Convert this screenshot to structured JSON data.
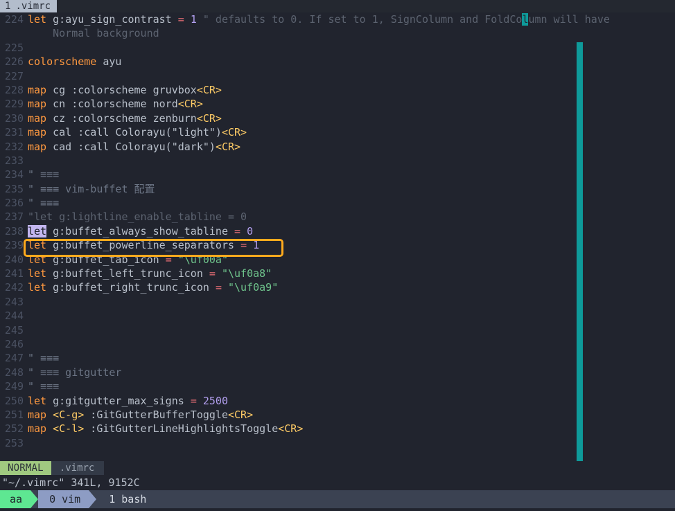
{
  "window": {
    "app": "vim",
    "bg_color": "#21242e",
    "accent_teal": "#0e9a9a",
    "annotation_color": "#ffaa1d"
  },
  "tabline": {
    "tabs": [
      {
        "number": "1",
        "name": ".vimrc",
        "active": true
      }
    ]
  },
  "editor": {
    "first_visible_line": 224,
    "cursor": {
      "line": 224,
      "char": "l",
      "word_context": "FoldColumn"
    },
    "lines": [
      {
        "num": "224",
        "segments": [
          {
            "t": "let",
            "c": "kw"
          },
          {
            "t": " g:ayu_sign_contrast ",
            "c": "ident"
          },
          {
            "t": "=",
            "c": "op"
          },
          {
            "t": " ",
            "c": "ident"
          },
          {
            "t": "1",
            "c": "num"
          },
          {
            "t": " ",
            "c": "ident"
          },
          {
            "t": "\" defaults to 0. If set to 1, SignColumn and FoldCo",
            "c": "cmt"
          },
          {
            "t": "l",
            "c": "cursor"
          },
          {
            "t": "umn will have",
            "c": "cmt"
          }
        ]
      },
      {
        "num": "",
        "segments": [
          {
            "t": "    Normal background",
            "c": "cmt"
          }
        ]
      },
      {
        "num": "225",
        "segments": []
      },
      {
        "num": "226",
        "segments": [
          {
            "t": "colorscheme",
            "c": "kw"
          },
          {
            "t": " ayu",
            "c": "ident"
          }
        ]
      },
      {
        "num": "227",
        "segments": []
      },
      {
        "num": "228",
        "segments": [
          {
            "t": "map",
            "c": "kw"
          },
          {
            "t": " cg :colorscheme gruvbox",
            "c": "ident"
          },
          {
            "t": "<CR>",
            "c": "spec"
          }
        ]
      },
      {
        "num": "229",
        "segments": [
          {
            "t": "map",
            "c": "kw"
          },
          {
            "t": " cn :colorscheme nord",
            "c": "ident"
          },
          {
            "t": "<CR>",
            "c": "spec"
          }
        ]
      },
      {
        "num": "230",
        "segments": [
          {
            "t": "map",
            "c": "kw"
          },
          {
            "t": " cz :colorscheme zenburn",
            "c": "ident"
          },
          {
            "t": "<CR>",
            "c": "spec"
          }
        ]
      },
      {
        "num": "231",
        "segments": [
          {
            "t": "map",
            "c": "kw"
          },
          {
            "t": " cal :call Colorayu(\"light\")",
            "c": "ident"
          },
          {
            "t": "<CR>",
            "c": "spec"
          }
        ]
      },
      {
        "num": "232",
        "segments": [
          {
            "t": "map",
            "c": "kw"
          },
          {
            "t": " cad :call Colorayu(\"dark\")",
            "c": "ident"
          },
          {
            "t": "<CR>",
            "c": "spec"
          }
        ]
      },
      {
        "num": "233",
        "segments": []
      },
      {
        "num": "234",
        "segments": [
          {
            "t": "\" ≡≡≡",
            "c": "cmt2"
          }
        ]
      },
      {
        "num": "235",
        "segments": [
          {
            "t": "\" ≡≡≡ vim-buffet 配置",
            "c": "cmt2"
          }
        ]
      },
      {
        "num": "236",
        "segments": [
          {
            "t": "\" ≡≡≡",
            "c": "cmt2"
          }
        ]
      },
      {
        "num": "237",
        "segments": [
          {
            "t": "\"let g:lightline_enable_tabline = 0",
            "c": "cmt"
          }
        ]
      },
      {
        "num": "238",
        "boxed": true,
        "segments": [
          {
            "t": "let",
            "c": "sel"
          },
          {
            "t": " g:buffet_always_show_tabline ",
            "c": "ident"
          },
          {
            "t": "=",
            "c": "op"
          },
          {
            "t": " ",
            "c": "ident"
          },
          {
            "t": "0",
            "c": "num"
          }
        ]
      },
      {
        "num": "239",
        "segments": [
          {
            "t": "let",
            "c": "kw"
          },
          {
            "t": " g:buffet_powerline_separators ",
            "c": "ident"
          },
          {
            "t": "=",
            "c": "op"
          },
          {
            "t": " ",
            "c": "ident"
          },
          {
            "t": "1",
            "c": "num"
          }
        ]
      },
      {
        "num": "240",
        "segments": [
          {
            "t": "let",
            "c": "kw"
          },
          {
            "t": " g:buffet_tab_icon ",
            "c": "ident"
          },
          {
            "t": "=",
            "c": "op"
          },
          {
            "t": " ",
            "c": "ident"
          },
          {
            "t": "\"\\uf00a\"",
            "c": "str"
          }
        ]
      },
      {
        "num": "241",
        "segments": [
          {
            "t": "let",
            "c": "kw"
          },
          {
            "t": " g:buffet_left_trunc_icon ",
            "c": "ident"
          },
          {
            "t": "=",
            "c": "op"
          },
          {
            "t": " ",
            "c": "ident"
          },
          {
            "t": "\"\\uf0a8\"",
            "c": "str"
          }
        ]
      },
      {
        "num": "242",
        "segments": [
          {
            "t": "let",
            "c": "kw"
          },
          {
            "t": " g:buffet_right_trunc_icon ",
            "c": "ident"
          },
          {
            "t": "=",
            "c": "op"
          },
          {
            "t": " ",
            "c": "ident"
          },
          {
            "t": "\"\\uf0a9\"",
            "c": "str"
          }
        ]
      },
      {
        "num": "243",
        "segments": []
      },
      {
        "num": "244",
        "segments": []
      },
      {
        "num": "245",
        "segments": []
      },
      {
        "num": "246",
        "segments": []
      },
      {
        "num": "247",
        "segments": [
          {
            "t": "\" ≡≡≡",
            "c": "cmt2"
          }
        ]
      },
      {
        "num": "248",
        "segments": [
          {
            "t": "\" ≡≡≡ gitgutter",
            "c": "cmt2"
          }
        ]
      },
      {
        "num": "249",
        "segments": [
          {
            "t": "\" ≡≡≡",
            "c": "cmt2"
          }
        ]
      },
      {
        "num": "250",
        "segments": [
          {
            "t": "let",
            "c": "kw"
          },
          {
            "t": " g:gitgutter_max_signs ",
            "c": "ident"
          },
          {
            "t": "=",
            "c": "op"
          },
          {
            "t": " ",
            "c": "ident"
          },
          {
            "t": "2500",
            "c": "num"
          }
        ]
      },
      {
        "num": "251",
        "segments": [
          {
            "t": "map",
            "c": "kw"
          },
          {
            "t": " ",
            "c": "ident"
          },
          {
            "t": "<C-g>",
            "c": "spec"
          },
          {
            "t": " :GitGutterBufferToggle",
            "c": "ident"
          },
          {
            "t": "<CR>",
            "c": "spec"
          }
        ]
      },
      {
        "num": "252",
        "segments": [
          {
            "t": "map",
            "c": "kw"
          },
          {
            "t": " ",
            "c": "ident"
          },
          {
            "t": "<C-l>",
            "c": "spec"
          },
          {
            "t": " :GitGutterLineHighlightsToggle",
            "c": "ident"
          },
          {
            "t": "<CR>",
            "c": "spec"
          }
        ]
      },
      {
        "num": "253",
        "segments": []
      }
    ]
  },
  "statusline": {
    "mode": "NORMAL",
    "filename": ".vimrc"
  },
  "messageline": {
    "text": "\"~/.vimrc\" 341L, 9152C"
  },
  "tmux": {
    "session": "aa",
    "windows": [
      {
        "label": "0 vim",
        "active": true
      },
      {
        "label": "1 bash",
        "active": false
      }
    ]
  }
}
